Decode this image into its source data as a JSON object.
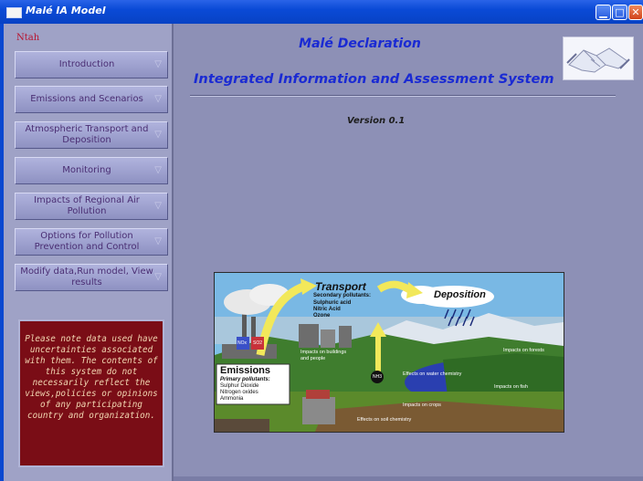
{
  "window": {
    "title": "Malé IA Model",
    "buttons": {
      "minimize": "▁",
      "maximize": "□",
      "close": "✕"
    }
  },
  "sidebar": {
    "header": "Ntah",
    "items": [
      {
        "label": "Introduction"
      },
      {
        "label": "Emissions and Scenarios"
      },
      {
        "label": "Atmospheric Transport and Deposition"
      },
      {
        "label": "Monitoring"
      },
      {
        "label": "Impacts of Regional Air Pollution"
      },
      {
        "label": "Options for Pollution Prevention and Control"
      },
      {
        "label": "Modify data,Run model, View results"
      }
    ],
    "chevron": "▽",
    "notice": "Please note data used have uncertainties associated with them. The contents of this system do not necessarily reflect the views,policies or opinions of any participating country and organization."
  },
  "main": {
    "title": "Malé Declaration",
    "subtitle": "Integrated Information and Assessment System",
    "version": "Version 0.1",
    "logo_icon": "handshake-icon"
  },
  "diagram": {
    "transport_title": "Transport",
    "transport_sub": "Secondary pollutants:",
    "transport_items": [
      "Sulphuric acid",
      "Nitric Acid",
      "Ozone"
    ],
    "deposition": "Deposition",
    "emissions_title": "Emissions",
    "emissions_sub": "Primary pollutants:",
    "emissions_items": [
      "Sulphur Dioxide",
      "Nitrogen oxides",
      "Ammonia"
    ],
    "impacts_buildings": "Impacts on buildings and people",
    "impacts_forests": "Impacts on forests",
    "effects_water": "Effects on water chemistry",
    "impacts_fish": "Impacts on fish",
    "impacts_crops": "Impacts on crops",
    "effects_soil": "Effects on soil chemistry",
    "nox": "NOx",
    "so2": "SO2",
    "nh3": "NH3"
  },
  "colors": {
    "title_blue": "#1a2ad3",
    "notice_bg": "#7a0d16",
    "notice_text": "#f2d7b2",
    "panel": "#8d90b6"
  }
}
